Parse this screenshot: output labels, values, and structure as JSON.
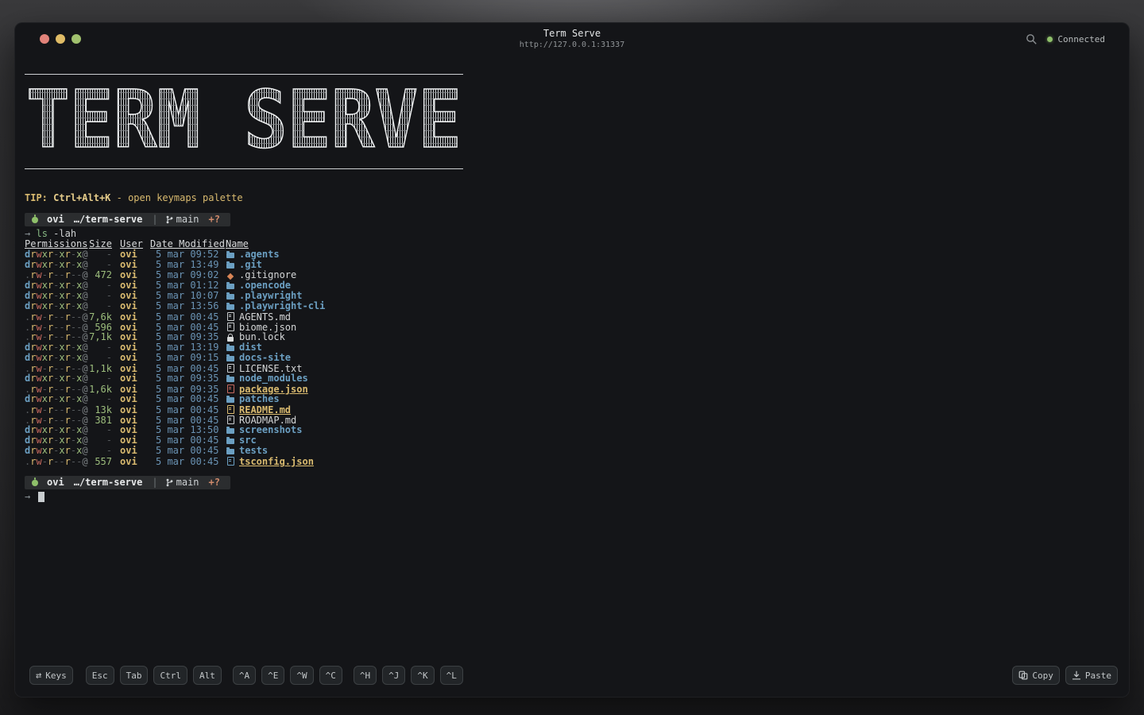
{
  "window": {
    "title": "Term Serve",
    "url": "http://127.0.0.1:31337",
    "status": "Connected"
  },
  "banner": {
    "text": "TERM SERVE"
  },
  "terminal": {
    "tip": {
      "label": "TIP:",
      "keys": "Ctrl+Alt+K",
      "text": "- open keymaps palette"
    },
    "prompt": {
      "user": "ovi",
      "path": "…/term-serve",
      "separator": "|",
      "branch": "main",
      "status": "+?"
    },
    "command": {
      "arrow": "→",
      "cmd": "ls",
      "args": "-lah"
    },
    "cursor_arrow": "→",
    "ls": {
      "headers": [
        "Permissions",
        "Size",
        "User",
        "Date Modified",
        "Name"
      ],
      "rows": [
        {
          "perms": "drwxr-xr-x@",
          "size": "-",
          "user": "ovi",
          "date": "5 mar 09:52",
          "name": ".agents",
          "type": "dir",
          "icon": "folder",
          "icon_color": "#6b9fc2"
        },
        {
          "perms": "drwxr-xr-x@",
          "size": "-",
          "user": "ovi",
          "date": "5 mar 13:49",
          "name": ".git",
          "type": "dir",
          "icon": "folder",
          "icon_color": "#6b9fc2"
        },
        {
          "perms": ".rw-r--r--@",
          "size": "472",
          "user": "ovi",
          "date": "5 mar 09:02",
          "name": ".gitignore",
          "type": "file",
          "icon": "git",
          "icon_color": "#d98556"
        },
        {
          "perms": "drwxr-xr-x@",
          "size": "-",
          "user": "ovi",
          "date": "5 mar 01:12",
          "name": ".opencode",
          "type": "dir",
          "icon": "folder",
          "icon_color": "#6b9fc2"
        },
        {
          "perms": "drwxr-xr-x@",
          "size": "-",
          "user": "ovi",
          "date": "5 mar 10:07",
          "name": ".playwright",
          "type": "dir",
          "icon": "folder",
          "icon_color": "#6b9fc2"
        },
        {
          "perms": "drwxr-xr-x@",
          "size": "-",
          "user": "ovi",
          "date": "5 mar 13:56",
          "name": ".playwright-cli",
          "type": "dir",
          "icon": "folder",
          "icon_color": "#6b9fc2"
        },
        {
          "perms": ".rw-r--r--@",
          "size": "7,6k",
          "user": "ovi",
          "date": "5 mar 00:45",
          "name": "AGENTS.md",
          "type": "file",
          "icon": "file",
          "icon_color": "#c9ccce"
        },
        {
          "perms": ".rw-r--r--@",
          "size": "596",
          "user": "ovi",
          "date": "5 mar 00:45",
          "name": "biome.json",
          "type": "file",
          "icon": "file",
          "icon_color": "#c9ccce"
        },
        {
          "perms": ".rw-r--r--@",
          "size": "7,1k",
          "user": "ovi",
          "date": "5 mar 09:35",
          "name": "bun.lock",
          "type": "file",
          "icon": "lock",
          "icon_color": "#d8dadb"
        },
        {
          "perms": "drwxr-xr-x@",
          "size": "-",
          "user": "ovi",
          "date": "5 mar 13:19",
          "name": "dist",
          "type": "dir",
          "icon": "folder",
          "icon_color": "#6b9fc2"
        },
        {
          "perms": "drwxr-xr-x@",
          "size": "-",
          "user": "ovi",
          "date": "5 mar 09:15",
          "name": "docs-site",
          "type": "dir",
          "icon": "folder",
          "icon_color": "#6b9fc2"
        },
        {
          "perms": ".rw-r--r--@",
          "size": "1,1k",
          "user": "ovi",
          "date": "5 mar 00:45",
          "name": "LICENSE.txt",
          "type": "file",
          "icon": "file",
          "icon_color": "#c9ccce"
        },
        {
          "perms": "drwxr-xr-x@",
          "size": "-",
          "user": "ovi",
          "date": "5 mar 09:35",
          "name": "node_modules",
          "type": "dir",
          "icon": "folder",
          "icon_color": "#6b9fc2"
        },
        {
          "perms": ".rw-r--r--@",
          "size": "1,6k",
          "user": "ovi",
          "date": "5 mar 09:35",
          "name": "package.json",
          "type": "special",
          "icon": "file",
          "icon_color": "#c96a5f"
        },
        {
          "perms": "drwxr-xr-x@",
          "size": "-",
          "user": "ovi",
          "date": "5 mar 00:45",
          "name": "patches",
          "type": "dir",
          "icon": "folder",
          "icon_color": "#6b9fc2"
        },
        {
          "perms": ".rw-r--r--@",
          "size": "13k",
          "user": "ovi",
          "date": "5 mar 00:45",
          "name": "README.md",
          "type": "special",
          "icon": "file",
          "icon_color": "#d9ba6f"
        },
        {
          "perms": ".rw-r--r--@",
          "size": "381",
          "user": "ovi",
          "date": "5 mar 00:45",
          "name": "ROADMAP.md",
          "type": "file",
          "icon": "file",
          "icon_color": "#c9ccce"
        },
        {
          "perms": "drwxr-xr-x@",
          "size": "-",
          "user": "ovi",
          "date": "5 mar 13:50",
          "name": "screenshots",
          "type": "dir",
          "icon": "folder",
          "icon_color": "#6b9fc2"
        },
        {
          "perms": "drwxr-xr-x@",
          "size": "-",
          "user": "ovi",
          "date": "5 mar 00:45",
          "name": "src",
          "type": "dir",
          "icon": "folder",
          "icon_color": "#6b9fc2"
        },
        {
          "perms": "drwxr-xr-x@",
          "size": "-",
          "user": "ovi",
          "date": "5 mar 00:45",
          "name": "tests",
          "type": "dir",
          "icon": "folder",
          "icon_color": "#6b9fc2"
        },
        {
          "perms": ".rw-r--r--@",
          "size": "557",
          "user": "ovi",
          "date": "5 mar 00:45",
          "name": "tsconfig.json",
          "type": "special",
          "icon": "file",
          "icon_color": "#6b9fc2"
        }
      ]
    }
  },
  "toolbar": {
    "keys_label": "Keys",
    "keys_icon": "⇄",
    "buttons_modifiers": [
      "Esc",
      "Tab",
      "Ctrl",
      "Alt"
    ],
    "buttons_ctrl_group1": [
      "^A",
      "^E",
      "^W",
      "^C"
    ],
    "buttons_ctrl_group2": [
      "^H",
      "^J",
      "^K",
      "^L"
    ],
    "copy_label": "Copy",
    "paste_label": "Paste"
  },
  "colors": {
    "bg-window": "#141518",
    "fg": "#d6d8d9",
    "yellow": "#d9ba6f",
    "blue": "#6b9fc2",
    "green": "#9cbd7c",
    "red": "#c96a5f",
    "accent-green": "#8fc06a"
  }
}
